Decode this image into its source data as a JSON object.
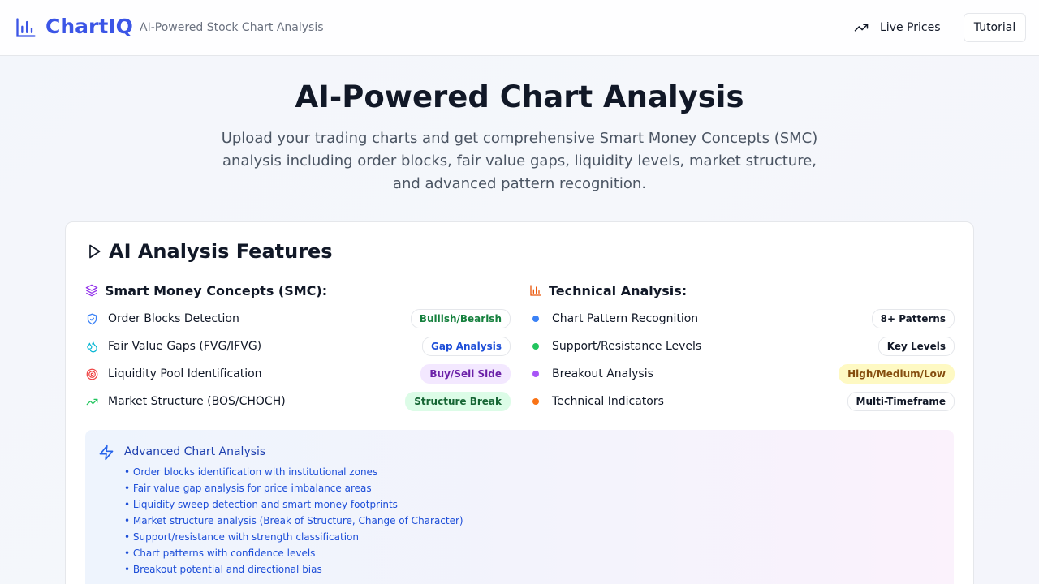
{
  "header": {
    "brand": "ChartIQ",
    "tagline": "AI-Powered Stock Chart Analysis",
    "live_prices": "Live Prices",
    "tutorial": "Tutorial"
  },
  "hero": {
    "title": "AI-Powered Chart Analysis",
    "subtitle": "Upload your trading charts and get comprehensive Smart Money Concepts (SMC) analysis including order blocks, fair value gaps, liquidity levels, market structure, and advanced pattern recognition."
  },
  "features": {
    "title": "AI Analysis Features",
    "smc": {
      "heading": "Smart Money Concepts (SMC):",
      "items": [
        {
          "label": "Order Blocks Detection",
          "badge": "Bullish/Bearish",
          "icon": "shield-icon"
        },
        {
          "label": "Fair Value Gaps (FVG/IFVG)",
          "badge": "Gap Analysis",
          "icon": "droplets-icon"
        },
        {
          "label": "Liquidity Pool Identification",
          "badge": "Buy/Sell Side",
          "icon": "target-icon"
        },
        {
          "label": "Market Structure (BOS/CHOCH)",
          "badge": "Structure Break",
          "icon": "trending-up-icon"
        }
      ]
    },
    "technical": {
      "heading": "Technical Analysis:",
      "items": [
        {
          "label": "Chart Pattern Recognition",
          "badge": "8+ Patterns",
          "dot_color": "#3b82f6"
        },
        {
          "label": "Support/Resistance Levels",
          "badge": "Key Levels",
          "dot_color": "#22c55e"
        },
        {
          "label": "Breakout Analysis",
          "badge": "High/Medium/Low",
          "dot_color": "#a855f7"
        },
        {
          "label": "Technical Indicators",
          "badge": "Multi-Timeframe",
          "dot_color": "#f97316"
        }
      ]
    },
    "advanced": {
      "title": "Advanced Chart Analysis",
      "items": [
        "• Order blocks identification with institutional zones",
        "• Fair value gap analysis for price imbalance areas",
        "• Liquidity sweep detection and smart money footprints",
        "• Market structure analysis (Break of Structure, Change of Character)",
        "• Support/resistance with strength classification",
        "• Chart patterns with confidence levels",
        "• Breakout potential and directional bias"
      ]
    }
  },
  "colors": {
    "brand": "#3b55e6",
    "smc_icon": "#9333ea",
    "technical_icon": "#ea580c"
  }
}
